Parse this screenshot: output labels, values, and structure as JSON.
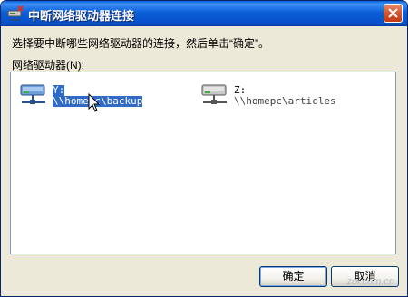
{
  "window": {
    "title": "中断网络驱动器连接",
    "icon": "network-drive-disconnect-icon",
    "close_icon": "close-icon"
  },
  "dialog": {
    "instruction": "选择要中断哪些网络驱动器的连接，然后单击“确定”。",
    "list_label": "网络驱动器(N):"
  },
  "drives": [
    {
      "letter": "Y:",
      "path": "\\\\homepc\\backup",
      "selected": true,
      "icon": "network-drive-icon"
    },
    {
      "letter": "Z:",
      "path": "\\\\homepc\\articles",
      "selected": false,
      "icon": "network-drive-icon"
    }
  ],
  "buttons": {
    "ok_label": "确定",
    "cancel_label": "取消"
  },
  "watermark": "zol.com.cn",
  "colors": {
    "titlebar": "#0a5fd8",
    "selection": "#316ac5",
    "dialog_bg": "#ece9d8",
    "listbox_border": "#7f9db9"
  }
}
